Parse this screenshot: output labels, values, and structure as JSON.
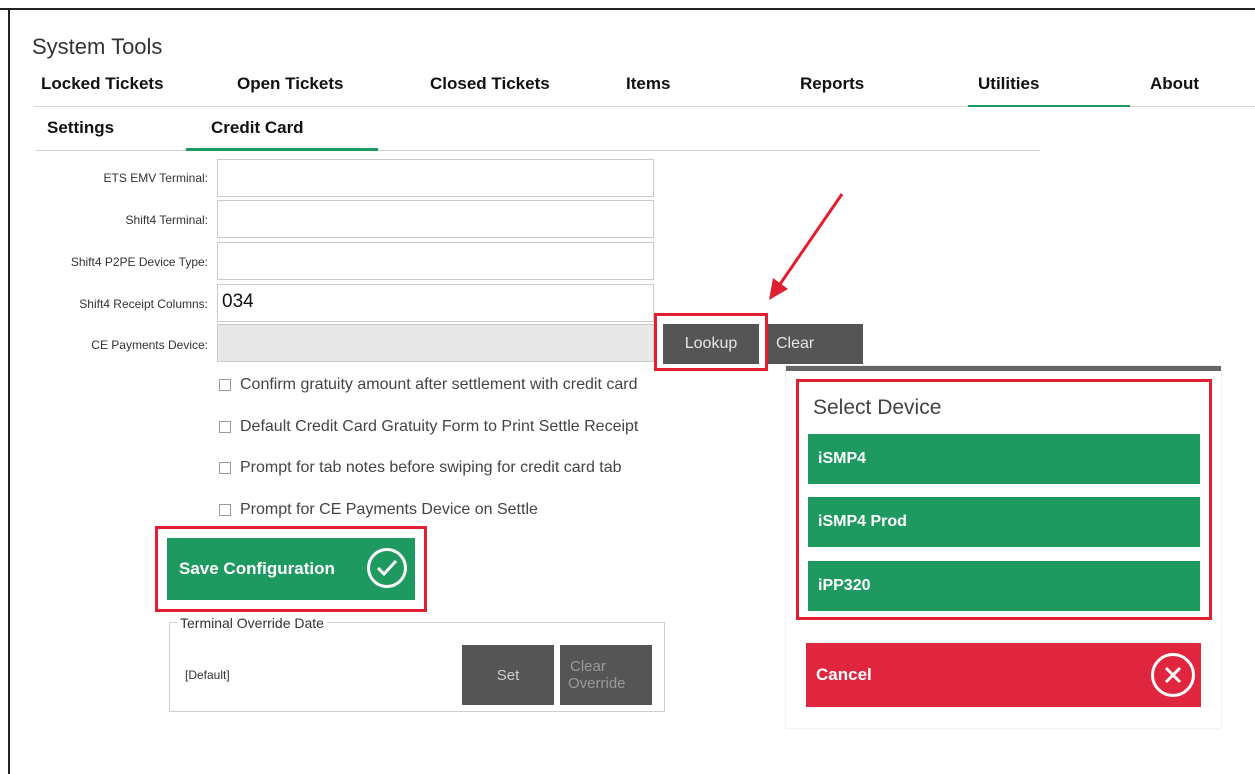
{
  "window": {
    "title": "System Tools"
  },
  "tabs": [
    "Locked Tickets",
    "Open Tickets",
    "Closed Tickets",
    "Items",
    "Reports",
    "Utilities",
    "About"
  ],
  "subtabs": [
    "Settings",
    "Credit Card"
  ],
  "form": {
    "ets_emv_label": "ETS EMV Terminal:",
    "ets_emv_value": "",
    "shift4_terminal_label": "Shift4 Terminal:",
    "shift4_terminal_value": "",
    "shift4_p2pe_label": "Shift4 P2PE Device Type:",
    "shift4_p2pe_value": "",
    "shift4_receipt_label": "Shift4 Receipt Columns:",
    "shift4_receipt_value": "034",
    "ce_device_label": "CE Payments Device:",
    "ce_device_value": "",
    "lookup_label": "Lookup",
    "clear_label": "Clear"
  },
  "options": [
    "Confirm gratuity amount after settlement with credit card",
    "Default Credit Card Gratuity Form to Print Settle Receipt",
    "Prompt for tab notes before swiping for credit card tab",
    "Prompt for CE Payments Device on Settle"
  ],
  "save": {
    "label": "Save Configuration"
  },
  "override": {
    "legend": "Terminal Override Date",
    "value": "[Default]",
    "set_label": "Set",
    "clear_label_line1": "Clear",
    "clear_label_line2": "Override"
  },
  "dialog": {
    "title": "Select Device",
    "devices": [
      "iSMP4",
      "iSMP4 Prod",
      "iPP320"
    ],
    "cancel_label": "Cancel"
  },
  "colors": {
    "green": "#1e9a61",
    "red": "#e0253f",
    "highlight": "#e02030"
  }
}
